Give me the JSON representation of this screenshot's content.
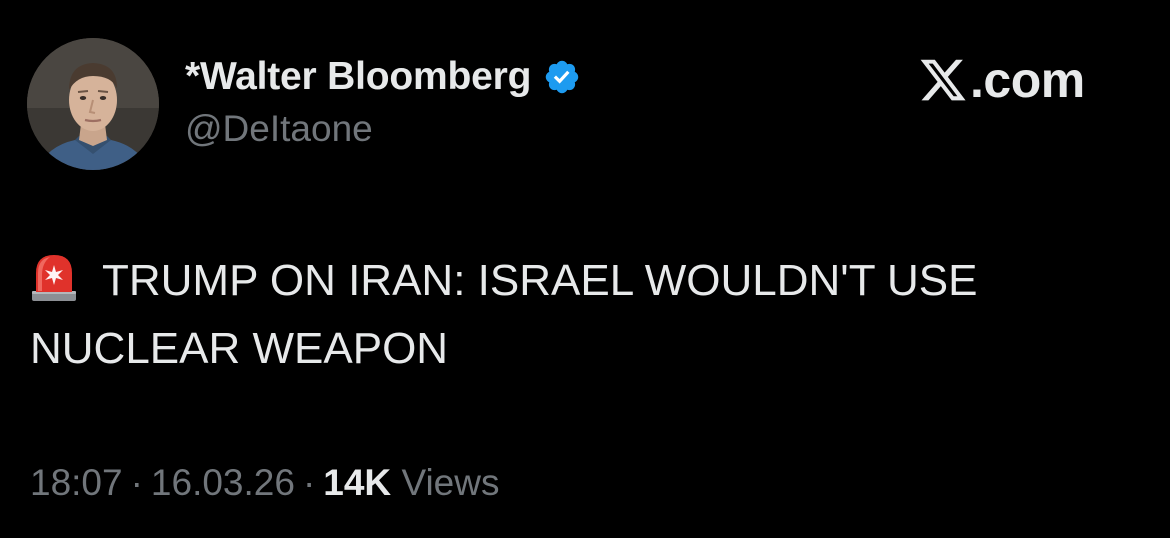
{
  "author": {
    "display_name": "*Walter Bloomberg",
    "handle": "@DeItaone",
    "verified": true,
    "verified_color": "#1d9bf0"
  },
  "brand": {
    "icon": "x-logo-icon",
    "text": ".com"
  },
  "tweet": {
    "emoji": "siren-icon",
    "line1": "TRUMP ON IRAN: ISRAEL WOULDN'T USE",
    "line2": "NUCLEAR WEAPON"
  },
  "meta": {
    "time": "18:07",
    "separator": "·",
    "date": "16.03.26",
    "views_count": "14K",
    "views_label": "Views"
  },
  "colors": {
    "background": "#000000",
    "primary_text": "#e7e9ea",
    "secondary_text": "#71767b",
    "siren_red": "#e0322b"
  }
}
